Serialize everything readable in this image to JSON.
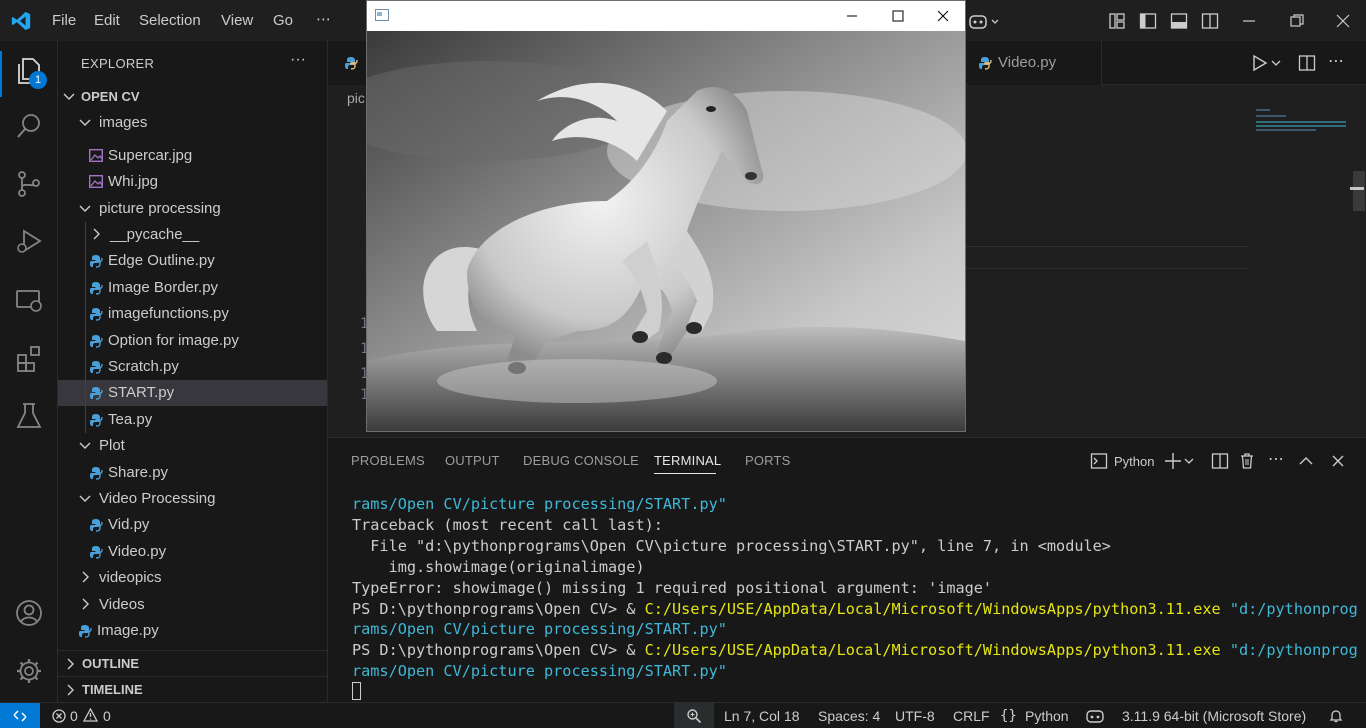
{
  "titlebar": {
    "menu": [
      "File",
      "Edit",
      "Selection",
      "View",
      "Go"
    ],
    "more": "⋯"
  },
  "activitybar": {
    "explorer_badge": "1"
  },
  "sidebar": {
    "title": "EXPLORER",
    "more": "···",
    "root": "OPEN CV",
    "items": [
      {
        "label": "images",
        "kind": "folder-open"
      },
      {
        "label": "Supercar.jpg",
        "kind": "image"
      },
      {
        "label": "Whi.jpg",
        "kind": "image"
      },
      {
        "label": "picture processing",
        "kind": "folder-open"
      },
      {
        "label": "__pycache__",
        "kind": "folder-closed"
      },
      {
        "label": "Edge Outline.py",
        "kind": "python"
      },
      {
        "label": "Image Border.py",
        "kind": "python"
      },
      {
        "label": "imagefunctions.py",
        "kind": "python"
      },
      {
        "label": "Option for image.py",
        "kind": "python"
      },
      {
        "label": "Scratch.py",
        "kind": "python"
      },
      {
        "label": "START.py",
        "kind": "python",
        "selected": true
      },
      {
        "label": "Tea.py",
        "kind": "python"
      },
      {
        "label": "Plot",
        "kind": "folder-open"
      },
      {
        "label": "Share.py",
        "kind": "python"
      },
      {
        "label": "Video Processing",
        "kind": "folder-open"
      },
      {
        "label": "Vid.py",
        "kind": "python"
      },
      {
        "label": "Video.py",
        "kind": "python"
      },
      {
        "label": "videopics",
        "kind": "folder-closed"
      },
      {
        "label": "Videos",
        "kind": "folder-closed"
      },
      {
        "label": "Image.py",
        "kind": "python"
      }
    ],
    "outline": "OUTLINE",
    "timeline": "TIMELINE"
  },
  "editor": {
    "tab_video": "Video.py",
    "breadcrumb_fragment": "pic",
    "line_number_fragment": "1"
  },
  "image_window": {
    "title": ""
  },
  "panel": {
    "tabs": [
      "PROBLEMS",
      "OUTPUT",
      "DEBUG CONSOLE",
      "TERMINAL",
      "PORTS"
    ],
    "active_tab": "TERMINAL",
    "terminal_profile": "Python",
    "terminal_lines": [
      {
        "parts": [
          {
            "t": "rams/Open CV/picture processing/START.py\"",
            "c": "str"
          }
        ]
      },
      {
        "parts": [
          {
            "t": "Traceback (most recent call last):",
            "c": ""
          }
        ]
      },
      {
        "parts": [
          {
            "t": "  File \"d:\\pythonprograms\\Open CV\\picture processing\\START.py\", line 7, in <module>",
            "c": ""
          }
        ]
      },
      {
        "parts": [
          {
            "t": "    img.showimage(originalimage)",
            "c": ""
          }
        ]
      },
      {
        "parts": [
          {
            "t": "TypeError: showimage() missing 1 required positional argument: 'image'",
            "c": ""
          }
        ]
      },
      {
        "parts": [
          {
            "t": "PS D:\\pythonprograms\\Open CV> & ",
            "c": ""
          },
          {
            "t": "C:/Users/USE/AppData/Local/Microsoft/WindowsApps/python3.11.exe",
            "c": "path"
          },
          {
            "t": " \"d:/pythonprog",
            "c": "str"
          }
        ]
      },
      {
        "parts": [
          {
            "t": "rams/Open CV/picture processing/START.py\"",
            "c": "str"
          }
        ]
      },
      {
        "parts": [
          {
            "t": "PS D:\\pythonprograms\\Open CV> & ",
            "c": ""
          },
          {
            "t": "C:/Users/USE/AppData/Local/Microsoft/WindowsApps/python3.11.exe",
            "c": "path"
          },
          {
            "t": " \"d:/pythonprog",
            "c": "str"
          }
        ]
      },
      {
        "parts": [
          {
            "t": "rams/Open CV/picture processing/START.py\"",
            "c": "str"
          }
        ]
      }
    ]
  },
  "statusbar": {
    "errors": "0",
    "warnings": "0",
    "position": "Ln 7, Col 18",
    "spaces": "Spaces: 4",
    "encoding": "UTF-8",
    "eol": "CRLF",
    "language": "Python",
    "interpreter": "3.11.9 64-bit (Microsoft Store)"
  },
  "colors": {
    "accent": "#0078d4",
    "terminal_string": "#3fb8d8",
    "terminal_path": "#e5e510",
    "python_icon": "#4a9fd8",
    "image_icon": "#a074c4"
  }
}
